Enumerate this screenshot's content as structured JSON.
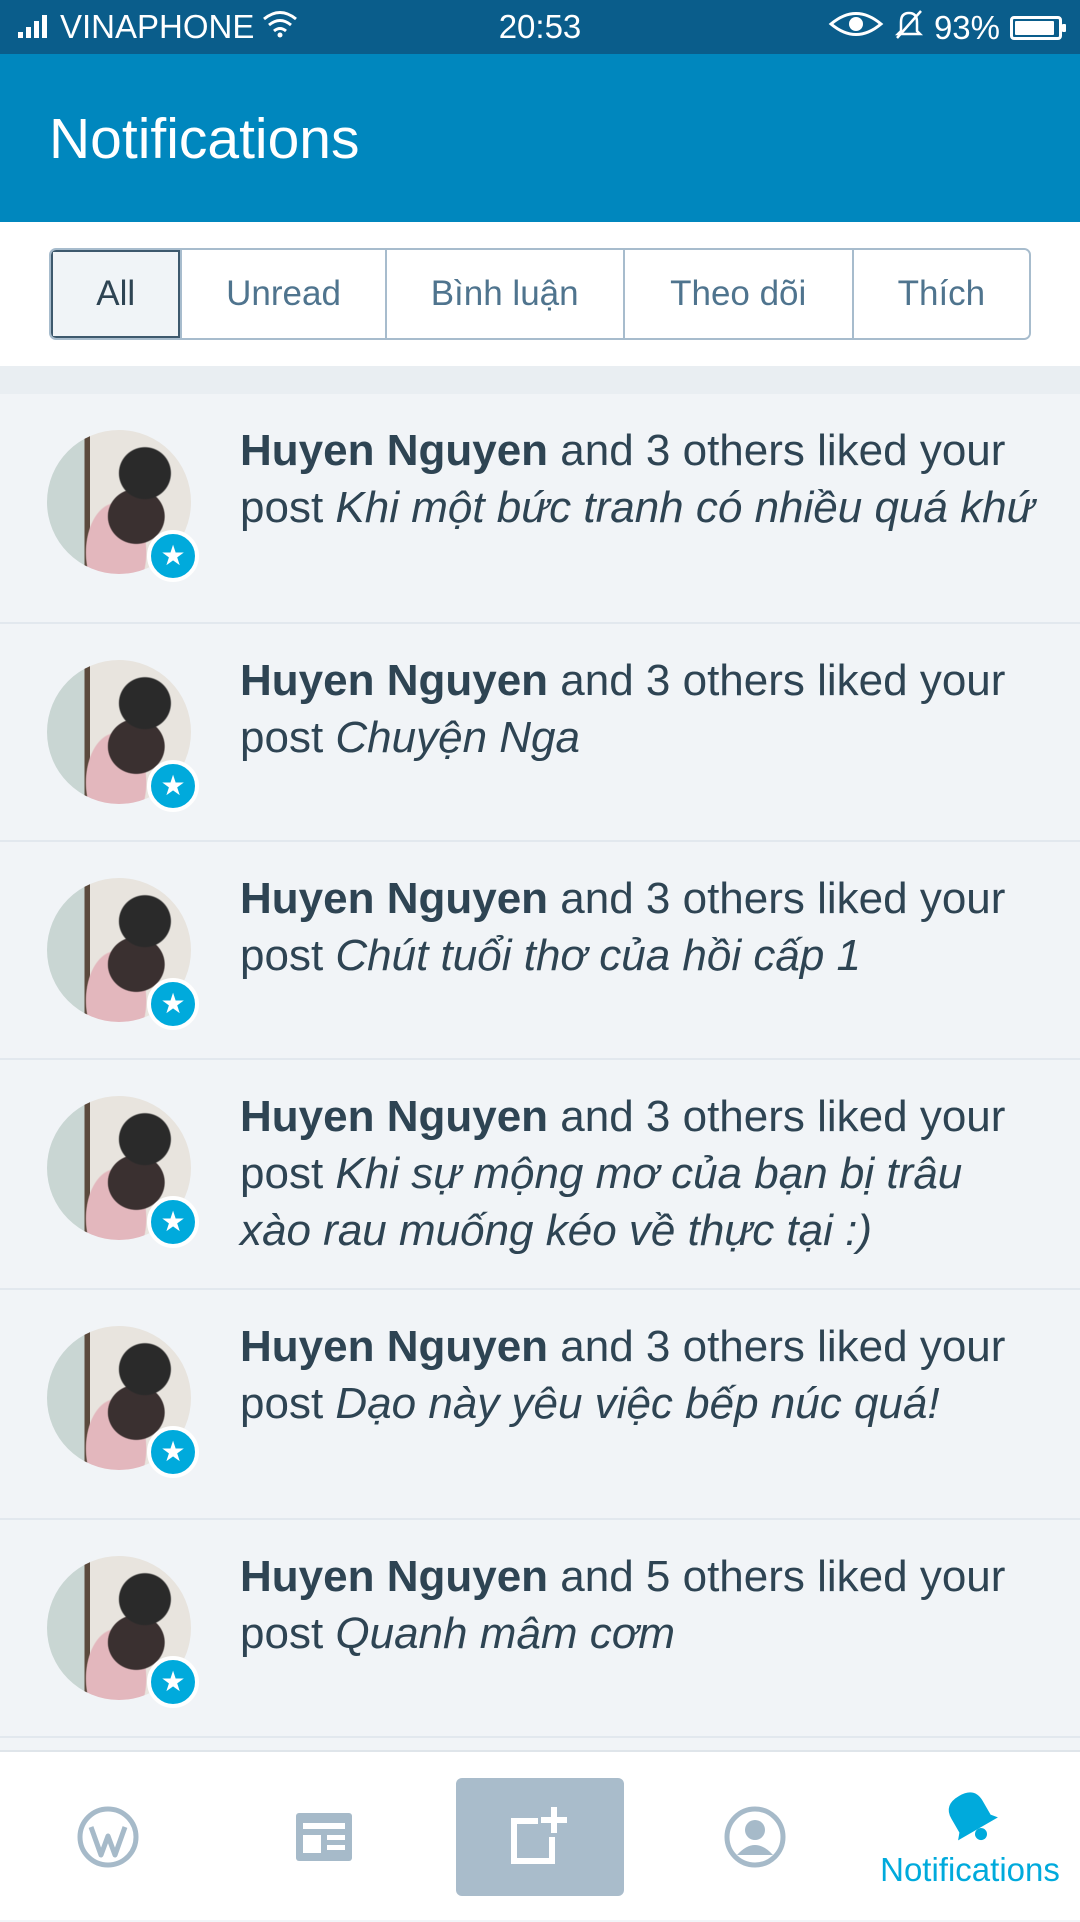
{
  "status_bar": {
    "carrier": "VINAPHONE",
    "time": "20:53",
    "battery": "93%",
    "battery_level": 0.93
  },
  "header": {
    "title": "Notifications"
  },
  "filters": [
    {
      "label": "All",
      "active": true
    },
    {
      "label": "Unread",
      "active": false
    },
    {
      "label": "Bình luận",
      "active": false
    },
    {
      "label": "Theo dõi",
      "active": false
    },
    {
      "label": "Thích",
      "active": false
    }
  ],
  "notifications": [
    {
      "name": "Huyen Nguyen",
      "action": " and 3 others liked your post ",
      "post": "Khi một bức tranh có nhiều quá khứ"
    },
    {
      "name": "Huyen Nguyen",
      "action": " and 3 others liked your post ",
      "post": "Chuyện Nga"
    },
    {
      "name": "Huyen Nguyen",
      "action": " and 3 others liked your post ",
      "post": "Chút tuổi thơ của hồi cấp 1"
    },
    {
      "name": "Huyen Nguyen",
      "action": " and 3 others liked your post ",
      "post": "Khi sự mộng mơ của bạn bị trâu xào rau muống kéo về thực tại :)"
    },
    {
      "name": "Huyen Nguyen",
      "action": " and 3 others liked your post ",
      "post": "Dạo này yêu việc bếp núc quá!"
    },
    {
      "name": "Huyen Nguyen",
      "action": " and 5 others liked your post ",
      "post": "Quanh mâm cơm"
    }
  ],
  "bottom_nav": {
    "items": [
      "wordpress-icon",
      "reader-icon",
      "write-icon",
      "profile-icon",
      "notifications-bell-icon"
    ],
    "notifications_label": "Notifications"
  },
  "colors": {
    "status_bar": "#0a5d8b",
    "app_bar": "#0087be",
    "accent": "#00aadc",
    "text": "#2e4453",
    "inactive_icon": "#a6bac9"
  }
}
